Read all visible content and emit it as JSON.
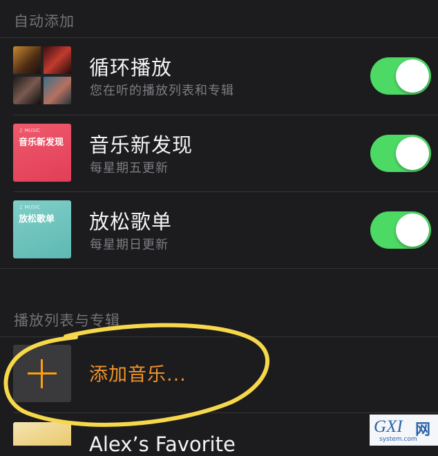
{
  "sections": {
    "auto_add": {
      "header": "自动添加"
    },
    "playlists": {
      "header": "播放列表与专辑"
    }
  },
  "auto_rows": [
    {
      "title": "循环播放",
      "subtitle": "您在听的播放列表和专辑",
      "toggle_on": true,
      "cover": "collage"
    },
    {
      "title": "音乐新发现",
      "subtitle": "每星期五更新",
      "toggle_on": true,
      "cover_label": "音乐新发现",
      "cover_mini": "♫ MUSIC",
      "cover_color": "#e8465f"
    },
    {
      "title": "放松歌单",
      "subtitle": "每星期日更新",
      "toggle_on": true,
      "cover_label": "放松歌单",
      "cover_mini": "♫ MUSIC",
      "cover_color": "#6cc3bf"
    }
  ],
  "add_music": {
    "label": "添加音乐...",
    "icon": "plus-icon"
  },
  "playlist_items": [
    {
      "title": "Alex’s Favorite"
    }
  ],
  "watermark": {
    "brand": "GXI",
    "brand_cn": "网",
    "domain": "system.com"
  },
  "colors": {
    "background": "#1c1c1e",
    "toggle_on": "#4cd964",
    "accent_orange": "#ff9f0a",
    "highlight_circle": "#f6d84a"
  }
}
